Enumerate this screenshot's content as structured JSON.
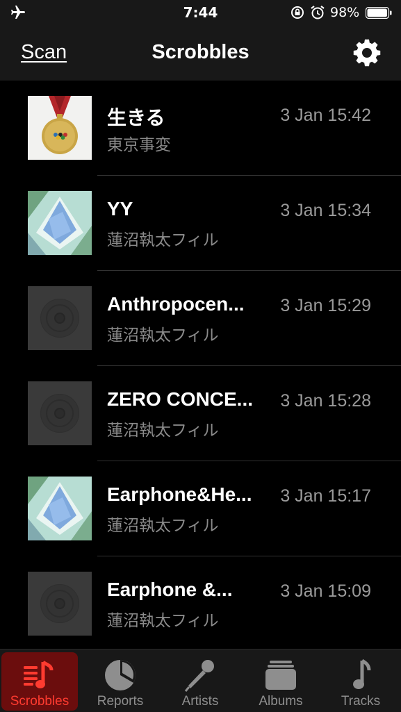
{
  "status_bar": {
    "time": "7:44",
    "battery": "98%"
  },
  "nav": {
    "left_button": "Scan",
    "title": "Scrobbles",
    "right_icon": "gear-icon"
  },
  "scrobbles": [
    {
      "title": "生きる",
      "artist": "東京事変",
      "time": "3 Jan 15:42",
      "art": "medal"
    },
    {
      "title": "YY",
      "artist": "蓮沼執太フィル",
      "time": "3 Jan 15:34",
      "art": "blue"
    },
    {
      "title": "Anthropocen...",
      "artist": "蓮沼執太フィル",
      "time": "3 Jan 15:29",
      "art": "placeholder"
    },
    {
      "title": "ZERO CONCE...",
      "artist": "蓮沼執太フィル",
      "time": "3 Jan 15:28",
      "art": "placeholder"
    },
    {
      "title": "Earphone&He...",
      "artist": "蓮沼執太フィル",
      "time": "3 Jan 15:17",
      "art": "blue"
    },
    {
      "title": "Earphone &...",
      "artist": "蓮沼執太フィル",
      "time": "3 Jan 15:09",
      "art": "placeholder"
    }
  ],
  "tabs": [
    {
      "label": "Scrobbles",
      "icon": "scrobbles-icon",
      "active": true
    },
    {
      "label": "Reports",
      "icon": "pie-chart-icon",
      "active": false
    },
    {
      "label": "Artists",
      "icon": "microphone-icon",
      "active": false
    },
    {
      "label": "Albums",
      "icon": "album-stack-icon",
      "active": false
    },
    {
      "label": "Tracks",
      "icon": "music-note-icon",
      "active": false
    }
  ],
  "colors": {
    "accent": "#ff3b30",
    "active_tab_bg": "#6b0d0d",
    "bar_bg": "#181818"
  }
}
